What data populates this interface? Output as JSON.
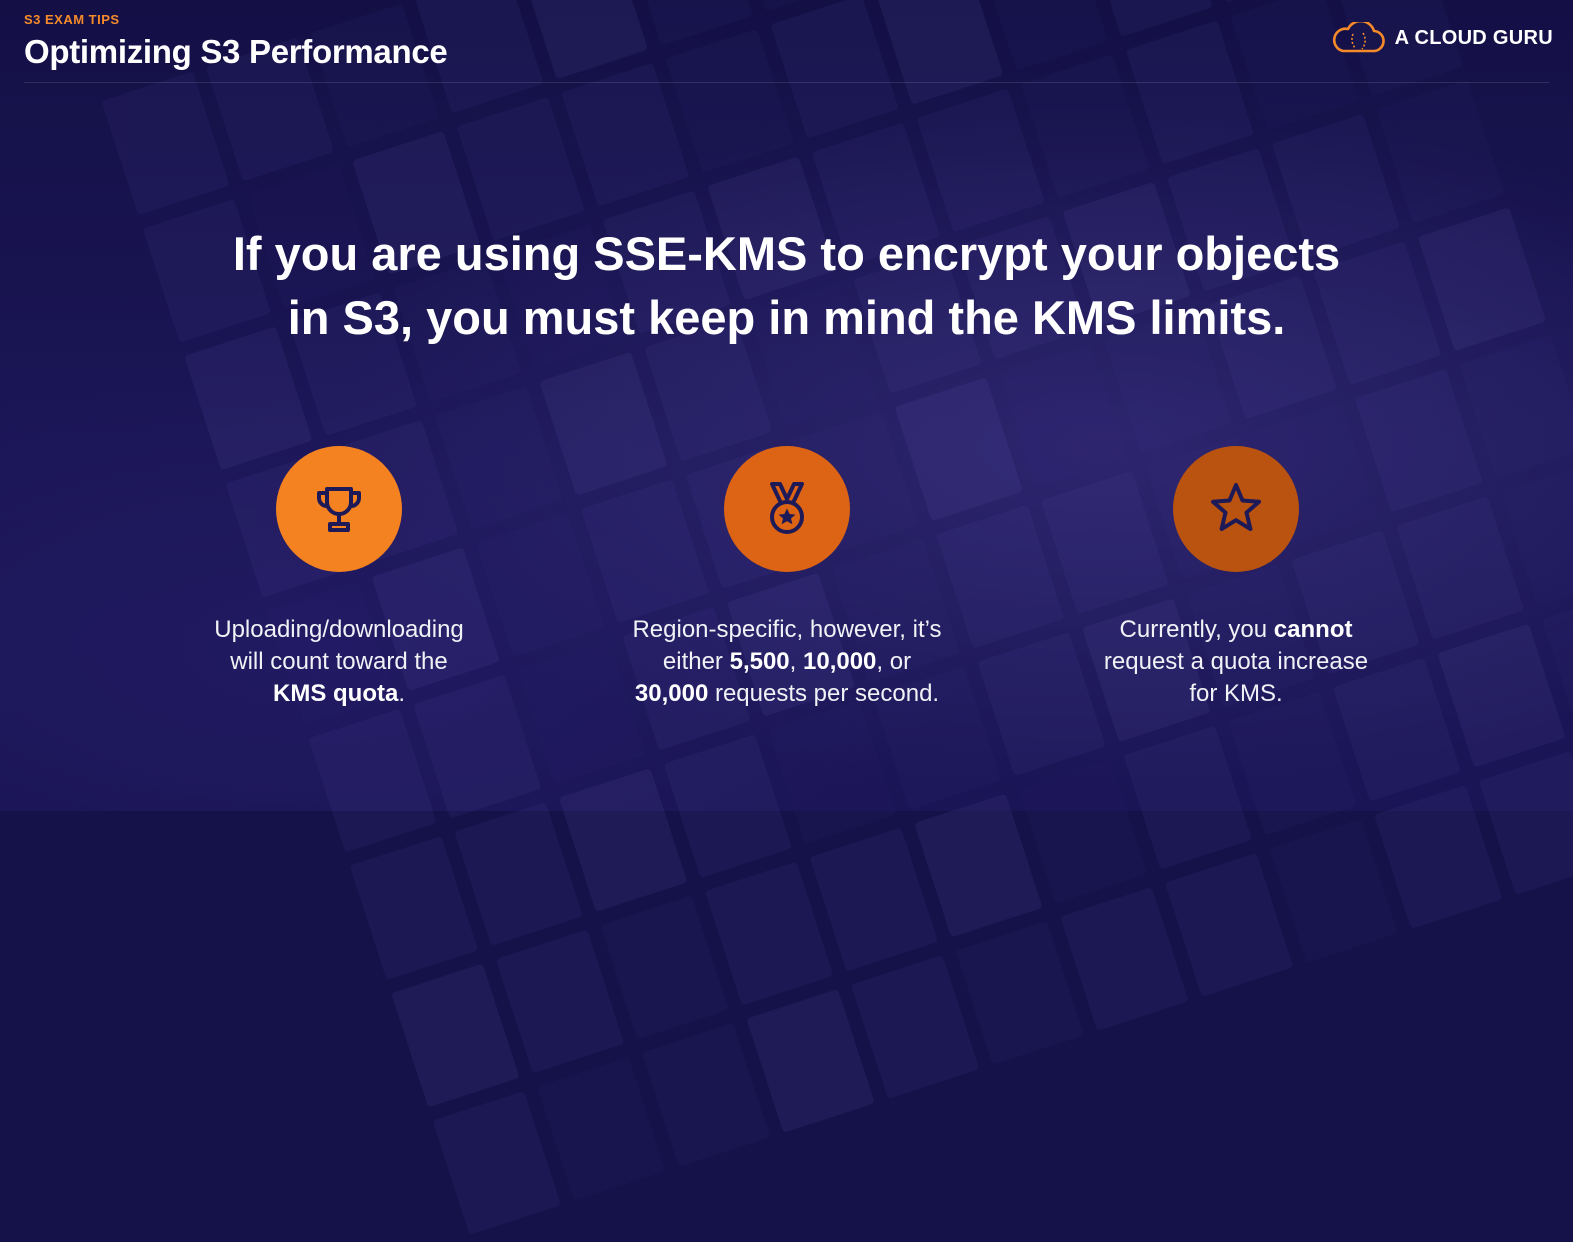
{
  "header": {
    "eyebrow": "S3 EXAM TIPS",
    "title": "Optimizing S3 Performance",
    "logo_text": "A CLOUD GURU"
  },
  "headline": {
    "line1": "If you are using SSE-KMS to encrypt your objects",
    "line2": "in S3, you must keep in mind the KMS limits."
  },
  "features": [
    {
      "icon": "trophy-icon",
      "color": "#f58220",
      "line1": "Uploading/downloading",
      "line2": "will count toward the",
      "line3_bold": "KMS quota",
      "line3_tail": "."
    },
    {
      "icon": "medal-icon",
      "color": "#dc6414",
      "line1": "Region-specific, however, it’s",
      "line2_pre": "either ",
      "line2_b1": "5,500",
      "line2_mid1": ", ",
      "line2_b2": "10,000",
      "line2_mid2": ", or",
      "line3_b": "30,000",
      "line3_tail": " requests per second."
    },
    {
      "icon": "star-icon",
      "color": "#b9530f",
      "line1_pre": "Currently, you ",
      "line1_bold": "cannot",
      "line2": "request a quota increase",
      "line3": "for KMS."
    }
  ],
  "colors": {
    "background": "#15124a",
    "accent": "#f58a2a",
    "icon_stroke": "#1e1a58"
  }
}
